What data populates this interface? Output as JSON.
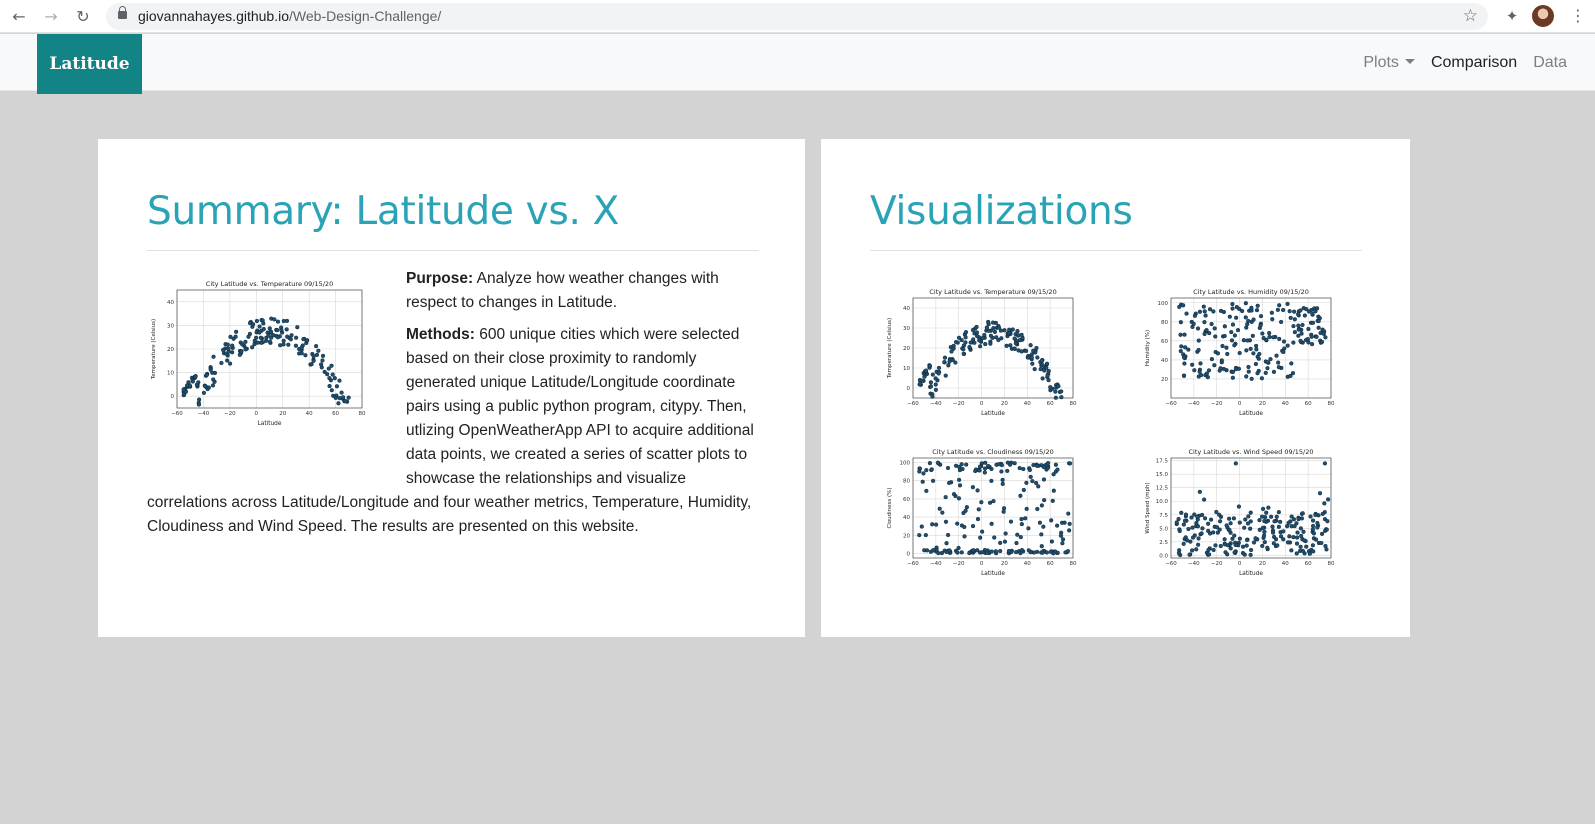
{
  "browser": {
    "url_host": "giovannahayes.github.io",
    "url_path": "/Web-Design-Challenge/"
  },
  "navbar": {
    "brand": "Latitude",
    "items": [
      {
        "label": "Plots",
        "dropdown": true
      },
      {
        "label": "Comparison",
        "active": true
      },
      {
        "label": "Data"
      }
    ]
  },
  "summary": {
    "title": "Summary: Latitude vs. X",
    "purpose_label": "Purpose:",
    "purpose_text": "Analyze how weather changes with respect to changes in Latitude.",
    "methods_label": "Methods:",
    "methods_text": "600 unique cities which were selected based on their close proximity to randomly generated unique Latitude/Longitude coordinate pairs using a public python program, citypy. Then, utlizing OpenWeatherApp API to acquire additional data points, we created a series of scatter plots to showcase the relationships and visualize correlations across Latitude/Longitude and four weather metrics, Temperature, Humidity, Cloudiness and Wind Speed. The results are presented on this website."
  },
  "visualizations": {
    "title": "Visualizations"
  },
  "colors": {
    "brand": "#138486",
    "heading": "#2aa3b7",
    "point": "#1f4e6e",
    "background": "#d3d3d3"
  },
  "plots": [
    {
      "id": "temp",
      "title": "City Latitude vs. Temperature 09/15/20",
      "xlabel": "Latitude",
      "ylabel": "Temperature (Celsius)",
      "xlim": [
        -60,
        80
      ],
      "ylim": [
        -5,
        45
      ],
      "yticks": [
        0,
        10,
        20,
        30,
        40
      ],
      "xticks": [
        -60,
        -40,
        -20,
        0,
        20,
        40,
        60,
        80
      ],
      "pattern": "arch"
    },
    {
      "id": "humidity",
      "title": "City Latitude vs. Humidity 09/15/20",
      "xlabel": "Latitude",
      "ylabel": "Humidity (%)",
      "xlim": [
        -60,
        80
      ],
      "ylim": [
        0,
        105
      ],
      "yticks": [
        20,
        40,
        60,
        80,
        100
      ],
      "xticks": [
        -60,
        -40,
        -20,
        0,
        20,
        40,
        60,
        80
      ],
      "pattern": "humid"
    },
    {
      "id": "cloud",
      "title": "City Latitude vs. Cloudiness 09/15/20",
      "xlabel": "Latitude",
      "ylabel": "Cloudiness (%)",
      "xlim": [
        -60,
        80
      ],
      "ylim": [
        -5,
        105
      ],
      "yticks": [
        0,
        20,
        40,
        60,
        80,
        100
      ],
      "xticks": [
        -60,
        -40,
        -20,
        0,
        20,
        40,
        60,
        80
      ],
      "pattern": "cloud"
    },
    {
      "id": "wind",
      "title": "City Latitude vs. Wind Speed 09/15/20",
      "xlabel": "Latitude",
      "ylabel": "Wind Speed (mph)",
      "xlim": [
        -60,
        80
      ],
      "ylim": [
        -0.5,
        18
      ],
      "yticks": [
        0.0,
        2.5,
        5.0,
        7.5,
        10.0,
        12.5,
        15.0,
        17.5
      ],
      "xticks": [
        -60,
        -40,
        -20,
        0,
        20,
        40,
        60,
        80
      ],
      "pattern": "wind"
    }
  ]
}
